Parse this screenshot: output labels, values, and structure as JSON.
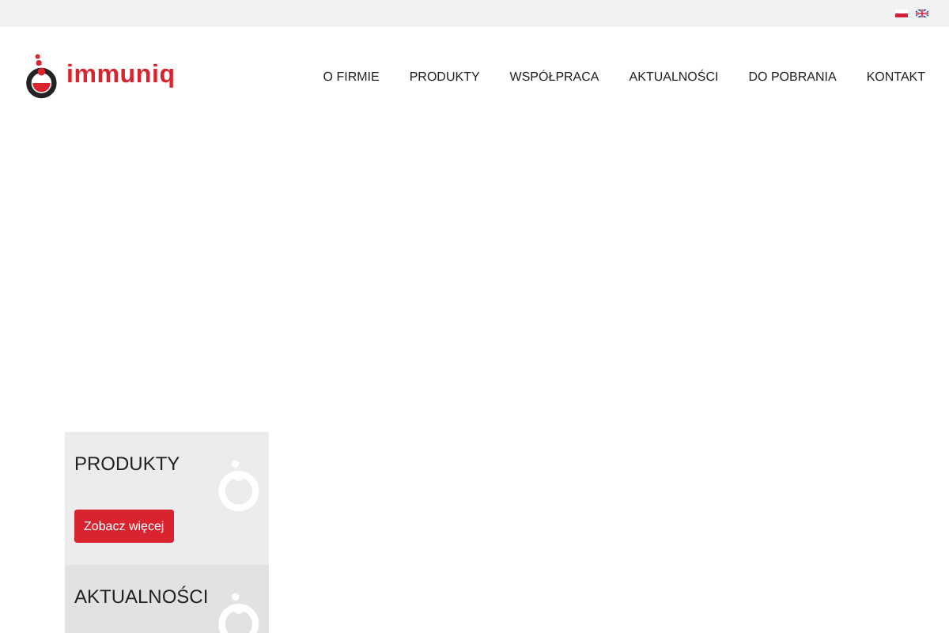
{
  "logo": {
    "text": "immuniq"
  },
  "nav": [
    {
      "label": "O FIRMIE"
    },
    {
      "label": "PRODUKTY"
    },
    {
      "label": "WSPÓŁPRACA"
    },
    {
      "label": "AKTUALNOŚCI"
    },
    {
      "label": "DO POBRANIA"
    },
    {
      "label": "KONTAKT"
    }
  ],
  "cards": [
    {
      "title": "PRODUKTY",
      "button": "Zobacz więcej"
    },
    {
      "title": "AKTUALNOŚCI"
    }
  ]
}
